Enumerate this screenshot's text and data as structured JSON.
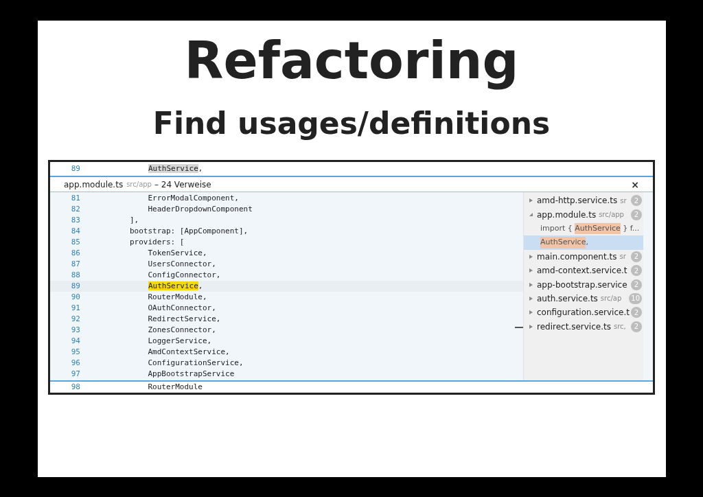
{
  "slide": {
    "title": "Refactoring",
    "subtitle": "Find usages/definitions"
  },
  "editor": {
    "top_line": {
      "number": "89",
      "match": "AuthService",
      "post": ","
    },
    "peek": {
      "file": "app.module.ts",
      "path": "src/app",
      "count": "– 24 Verweise",
      "close": "×",
      "lines": [
        {
          "number": "81",
          "pre": "    ErrorModalComponent,"
        },
        {
          "number": "82",
          "pre": "    HeaderDropdownComponent"
        },
        {
          "number": "83",
          "pre": "],"
        },
        {
          "number": "84",
          "pre": "bootstrap: [AppComponent],"
        },
        {
          "number": "85",
          "pre": "providers: ["
        },
        {
          "number": "86",
          "pre": "    TokenService,"
        },
        {
          "number": "87",
          "pre": "    UsersConnector,"
        },
        {
          "number": "88",
          "pre": "    ConfigConnector,"
        },
        {
          "number": "89",
          "match": "AuthService",
          "post": ","
        },
        {
          "number": "90",
          "pre": "    RouterModule,"
        },
        {
          "number": "91",
          "pre": "    OAuthConnector,"
        },
        {
          "number": "92",
          "pre": "    RedirectService,"
        },
        {
          "number": "93",
          "pre": "    ZonesConnector,"
        },
        {
          "number": "94",
          "pre": "    LoggerService,"
        },
        {
          "number": "95",
          "pre": "    AmdContextService,"
        },
        {
          "number": "96",
          "pre": "    ConfigurationService,"
        },
        {
          "number": "97",
          "pre": "    AppBootstrapService"
        }
      ],
      "references": [
        {
          "name": "amd-http.service.ts",
          "path": "sr",
          "count": "2",
          "expanded": false
        },
        {
          "name": "app.module.ts",
          "path": "src/app",
          "count": "2",
          "expanded": true,
          "children": [
            {
              "pre": "import { ",
              "match": "AuthService",
              "post": " } f...",
              "selected": false
            },
            {
              "match": "AuthService",
              "post": ",",
              "selected": true
            }
          ]
        },
        {
          "name": "main.component.ts",
          "path": "sr",
          "count": "2",
          "expanded": false
        },
        {
          "name": "amd-context.service.t",
          "count": "2",
          "expanded": false
        },
        {
          "name": "app-bootstrap.service",
          "count": "2",
          "expanded": false
        },
        {
          "name": "auth.service.ts",
          "path": "src/ap",
          "count": "10",
          "expanded": false
        },
        {
          "name": "configuration.service.t",
          "count": "2",
          "expanded": false
        },
        {
          "name": "redirect.service.ts",
          "path": "src,",
          "count": "2",
          "expanded": false
        }
      ]
    },
    "bottom_line": {
      "number": "98",
      "pre": "    RouterModule"
    }
  }
}
